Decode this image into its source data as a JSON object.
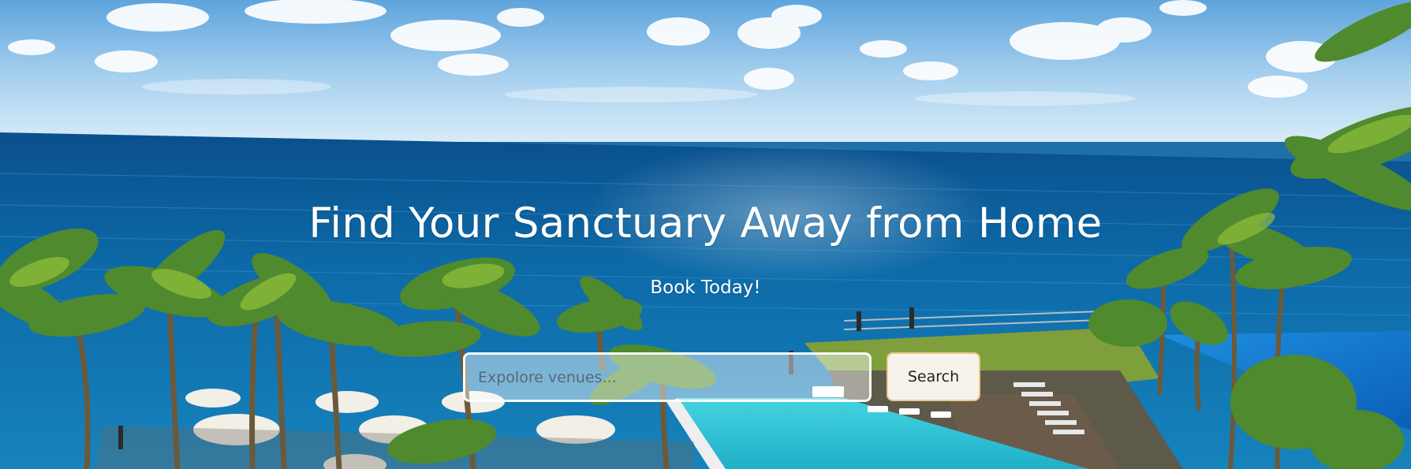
{
  "hero": {
    "title": "Find Your Sanctuary Away from Home",
    "subtitle": "Book Today!",
    "background_image": "tropical-resort-ocean-view-with-infinity-pool-and-palm-trees"
  },
  "search": {
    "placeholder": "Expolore venues...",
    "value": "",
    "button_label": "Search"
  },
  "colors": {
    "sky": "#8cc4ea",
    "ocean": "#0f6aa6",
    "palm": "#4f8a2e",
    "pool": "#2fc3d6",
    "button_bg": "#f7f2ea",
    "button_border": "#e8c98e",
    "title_text": "#ffffff"
  }
}
